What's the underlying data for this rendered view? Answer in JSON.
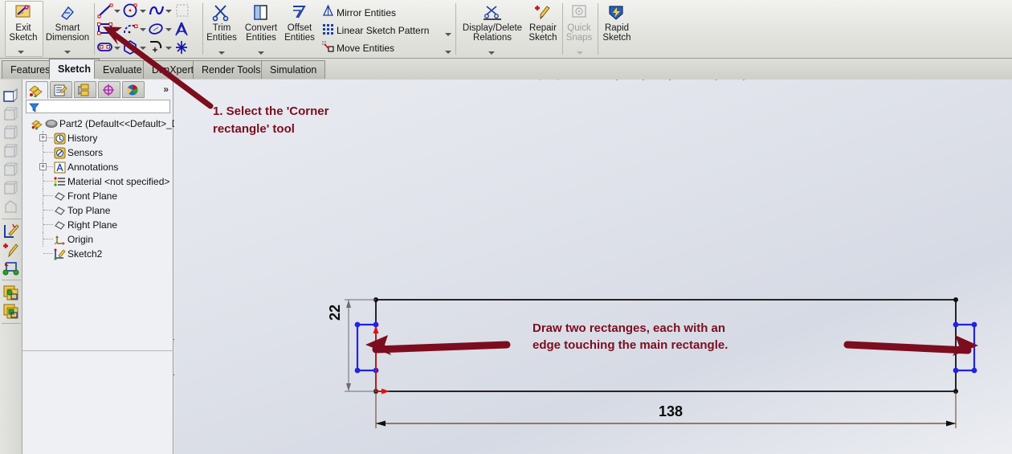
{
  "ribbon": {
    "exit_sketch": "Exit\nSketch",
    "exit_sketch_label": "Exit Sketch",
    "smart_dimension": "Smart\nDimension",
    "smart_dimension_label": "Smart Dimension",
    "trim_entities": "Trim\nEntities",
    "convert_entities": "Convert\nEntities",
    "offset_entities": "Offset\nEntities",
    "display_delete_relations": "Display/Delete\nRelations",
    "repair_sketch": "Repair\nSketch",
    "quick_snaps": "Quick\nSnaps",
    "rapid_sketch": "Rapid\nSketch",
    "text_items": [
      {
        "label": "Mirror Entities",
        "icon": "mirror-entities-icon",
        "has_dropdown": false
      },
      {
        "label": "Linear Sketch Pattern",
        "icon": "linear-sketch-pattern-icon",
        "has_dropdown": true
      },
      {
        "label": "Move Entities",
        "icon": "move-entities-icon",
        "has_dropdown": true
      }
    ],
    "sketch_tools": [
      {
        "name": "line-tool",
        "dropdown": true
      },
      {
        "name": "circle-tool",
        "dropdown": true
      },
      {
        "name": "spline-tool",
        "dropdown": true
      },
      {
        "name": "3d-sketch-plane-tool",
        "dropdown": false
      },
      {
        "name": "corner-rectangle-tool",
        "dropdown": true
      },
      {
        "name": "centerpoint-arc-tool",
        "dropdown": true
      },
      {
        "name": "ellipse-tool",
        "dropdown": true
      },
      {
        "name": "sketch-text-tool",
        "dropdown": false
      },
      {
        "name": "straight-slot-tool",
        "dropdown": true
      },
      {
        "name": "polygon-tool",
        "dropdown": true
      },
      {
        "name": "tangent-arc-tool",
        "dropdown": true
      },
      {
        "name": "point-tool",
        "dropdown": false
      }
    ]
  },
  "command_tabs": [
    {
      "label": "Features",
      "active": false
    },
    {
      "label": "Sketch",
      "active": true
    },
    {
      "label": "Evaluate",
      "active": false
    },
    {
      "label": "DimXpert",
      "active": false
    },
    {
      "label": "Render Tools",
      "active": false
    },
    {
      "label": "Simulation",
      "active": false
    }
  ],
  "feature_manager": {
    "tabs": [
      {
        "name": "feature-tree-tab",
        "active": true
      },
      {
        "name": "property-manager-tab",
        "active": false
      },
      {
        "name": "configuration-manager-tab",
        "active": false
      },
      {
        "name": "dimxpert-manager-tab",
        "active": false
      },
      {
        "name": "display-manager-tab",
        "active": false
      }
    ],
    "expand_chevron": "»",
    "filter_placeholder": "",
    "tree": [
      {
        "label": "Part2  (Default<<Default>_D",
        "icon": "part-icon",
        "indent": 0,
        "expandable": false,
        "root": true
      },
      {
        "label": "History",
        "icon": "history-icon",
        "indent": 1,
        "expandable": true
      },
      {
        "label": "Sensors",
        "icon": "sensors-icon",
        "indent": 1,
        "expandable": false
      },
      {
        "label": "Annotations",
        "icon": "annotations-icon",
        "indent": 1,
        "expandable": true
      },
      {
        "label": "Material <not specified>",
        "icon": "material-icon",
        "indent": 1,
        "expandable": false
      },
      {
        "label": "Front Plane",
        "icon": "plane-icon",
        "indent": 1,
        "expandable": false
      },
      {
        "label": "Top Plane",
        "icon": "plane-icon",
        "indent": 1,
        "expandable": false
      },
      {
        "label": "Right Plane",
        "icon": "plane-icon",
        "indent": 1,
        "expandable": false
      },
      {
        "label": "Origin",
        "icon": "origin-icon",
        "indent": 1,
        "expandable": false
      },
      {
        "label": "Sketch2",
        "icon": "sketch-icon",
        "indent": 1,
        "expandable": false
      }
    ]
  },
  "view_toolbar": [
    {
      "name": "zoom-to-fit-icon",
      "dropdown": false
    },
    {
      "name": "zoom-to-area-icon",
      "dropdown": false
    },
    {
      "name": "previous-view-icon",
      "dropdown": false
    },
    {
      "name": "section-view-icon",
      "dropdown": false
    },
    {
      "name": "view-orientation-icon",
      "dropdown": true
    },
    {
      "name": "display-style-icon",
      "dropdown": true
    },
    {
      "name": "hide-show-items-icon",
      "dropdown": true
    },
    {
      "name": "edit-appearance-icon",
      "dropdown": false
    },
    {
      "name": "apply-scene-icon",
      "dropdown": true
    },
    {
      "name": "view-settings-icon",
      "dropdown": true
    }
  ],
  "annotations": {
    "step1": "1. Select the 'Corner\nrectangle' tool",
    "step2": "Draw two rectanges, each with an\nedge touching the main rectangle."
  },
  "sketch": {
    "width_dimension": "138",
    "height_dimension": "22",
    "colors": {
      "annotation": "#7c0d1e",
      "sketch_line": "#101010",
      "selected_entity": "#2222e0",
      "origin": "#e01010",
      "dimension": "#6b3b14"
    }
  }
}
